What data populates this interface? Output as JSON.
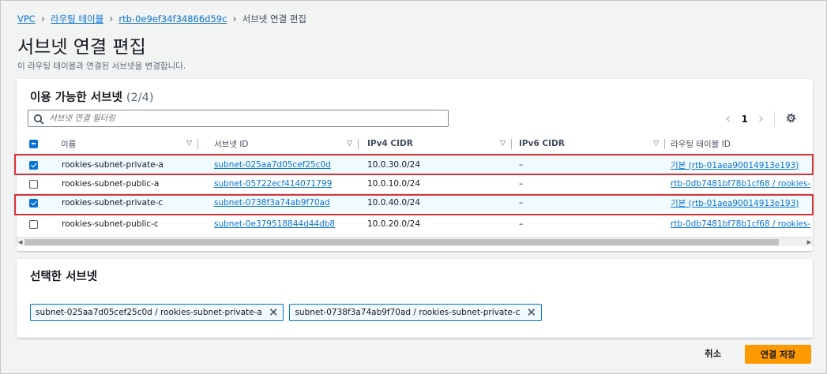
{
  "breadcrumb": {
    "items": [
      "VPC",
      "라우팅 테이블",
      "rtb-0e9ef34f34866d59c"
    ],
    "current": "서브넷 연결 편집"
  },
  "page": {
    "title": "서브넷 연결 편집",
    "description": "이 라우팅 테이블과 연결된 서브넷을 변경합니다."
  },
  "available": {
    "title": "이용 가능한 서브넷",
    "count": "(2/4)",
    "filter_placeholder": "서브넷 연결 필터링",
    "page_number": "1",
    "columns": [
      "이름",
      "서브넷 ID",
      "IPv4 CIDR",
      "IPv6 CIDR",
      "라우팅 테이블 ID"
    ],
    "rows": [
      {
        "checked": true,
        "name": "rookies-subnet-private-a",
        "subnet_id": "subnet-025aa7d05cef25c0d",
        "ipv4": "10.0.30.0/24",
        "ipv6": "–",
        "route_table": "기본 (rtb-01aea90014913e193)"
      },
      {
        "checked": false,
        "name": "rookies-subnet-public-a",
        "subnet_id": "subnet-05722ecf414071799",
        "ipv4": "10.0.10.0/24",
        "ipv6": "–",
        "route_table": "rtb-0db7481bf78b1cf68 / rookies-"
      },
      {
        "checked": true,
        "name": "rookies-subnet-private-c",
        "subnet_id": "subnet-0738f3a74ab9f70ad",
        "ipv4": "10.0.40.0/24",
        "ipv6": "–",
        "route_table": "기본 (rtb-01aea90014913e193)"
      },
      {
        "checked": false,
        "name": "rookies-subnet-public-c",
        "subnet_id": "subnet-0e379518844d44db8",
        "ipv4": "10.0.20.0/24",
        "ipv6": "–",
        "route_table": "rtb-0db7481bf78b1cf68 / rookies-"
      }
    ]
  },
  "selected": {
    "title": "선택한 서브넷",
    "tokens": [
      "subnet-025aa7d05cef25c0d / rookies-subnet-private-a",
      "subnet-0738f3a74ab9f70ad / rookies-subnet-private-c"
    ]
  },
  "actions": {
    "cancel": "취소",
    "save": "연결 저장"
  },
  "colors": {
    "link": "#0972d3",
    "primary_button": "#ff9900",
    "highlight": "#d8333b"
  }
}
